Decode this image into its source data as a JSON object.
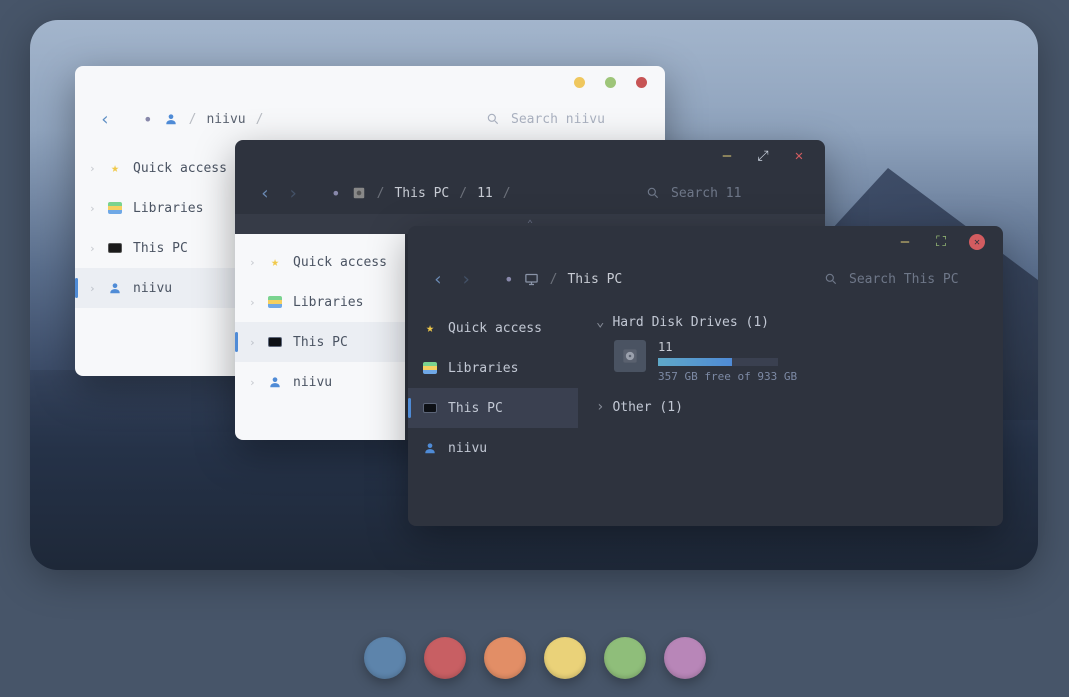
{
  "window_light": {
    "traffic": {
      "min": "#efc75e",
      "max": "#9ec579",
      "close": "#c75455"
    },
    "breadcrumb": [
      "niivu"
    ],
    "search_placeholder": "Search niivu",
    "sidebar": [
      {
        "label": "Quick access",
        "icon": "star",
        "expandable": true,
        "active": false
      },
      {
        "label": "Libraries",
        "icon": "lib",
        "expandable": true,
        "active": false
      },
      {
        "label": "This PC",
        "icon": "pc",
        "expandable": true,
        "active": false
      },
      {
        "label": "niivu",
        "icon": "user",
        "expandable": true,
        "active": true
      }
    ]
  },
  "window_dark1": {
    "buttons": {
      "min": "#e8d37a",
      "max": "#c8d0dc",
      "close": "#d25c60"
    },
    "breadcrumb": [
      "This PC",
      "11"
    ],
    "search_placeholder": "Search 11",
    "sidebar": [
      {
        "label": "Quick access",
        "icon": "star",
        "active": false
      },
      {
        "label": "Libraries",
        "icon": "lib",
        "active": false
      },
      {
        "label": "This PC",
        "icon": "pc",
        "active": true
      },
      {
        "label": "niivu",
        "icon": "user",
        "active": false
      }
    ]
  },
  "window_dark2": {
    "buttons": {
      "min": "#e8d37a",
      "max": "#9ec579",
      "close": "#d25c60"
    },
    "breadcrumb": [
      "This PC"
    ],
    "search_placeholder": "Search This PC",
    "sidebar": [
      {
        "label": "Quick access",
        "icon": "star",
        "active": false
      },
      {
        "label": "Libraries",
        "icon": "lib",
        "active": false
      },
      {
        "label": "This PC",
        "icon": "pc",
        "active": true
      },
      {
        "label": "niivu",
        "icon": "user",
        "active": false
      }
    ],
    "groups": [
      {
        "title": "Hard Disk Drives",
        "count": 1,
        "expanded": true,
        "drives": [
          {
            "name": "11",
            "free_text": "357 GB free of 933 GB",
            "used_pct": 62
          }
        ]
      },
      {
        "title": "Other",
        "count": 1,
        "expanded": false,
        "drives": []
      }
    ]
  },
  "palette": [
    "#5d84ab",
    "#c85f63",
    "#e28e66",
    "#ead279",
    "#8fbe7a",
    "#b886b8"
  ]
}
